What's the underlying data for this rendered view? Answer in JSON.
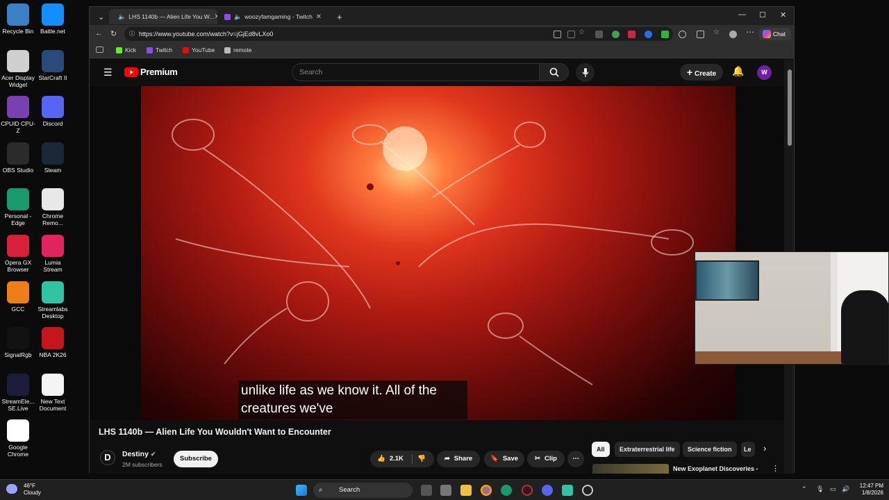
{
  "desktop": {
    "icons": [
      {
        "label": "Recycle Bin",
        "icon": "recycle-bin-icon",
        "color": "#3b7fc4"
      },
      {
        "label": "Battle.net",
        "icon": "battlenet-icon",
        "color": "#148eff"
      },
      {
        "label": "Acer Display Widget",
        "icon": "acer-display-icon",
        "color": "#cfcfcf"
      },
      {
        "label": "StarCraft II",
        "icon": "starcraft-icon",
        "color": "#2a4a7a"
      },
      {
        "label": "CPUID CPU-Z",
        "icon": "cpuz-icon",
        "color": "#7a3fb0"
      },
      {
        "label": "Discord",
        "icon": "discord-icon",
        "color": "#5865f2"
      },
      {
        "label": "OBS Studio",
        "icon": "obs-icon",
        "color": "#2b2b2b"
      },
      {
        "label": "Steam",
        "icon": "steam-icon",
        "color": "#1b2838"
      },
      {
        "label": "Personal - Edge",
        "icon": "edge-icon",
        "color": "#1a9a6c"
      },
      {
        "label": "Chrome Remo...",
        "icon": "chrome-remote-icon",
        "color": "#e8e8e8"
      },
      {
        "label": "Opera GX Browser",
        "icon": "opera-gx-icon",
        "color": "#d8203a"
      },
      {
        "label": "Lumia Stream",
        "icon": "lumia-icon",
        "color": "#e0245e"
      },
      {
        "label": "GCC",
        "icon": "gcc-icon",
        "color": "#ef7d1a"
      },
      {
        "label": "Streamlabs Desktop",
        "icon": "streamlabs-icon",
        "color": "#31c3a2"
      },
      {
        "label": "SignalRgb",
        "icon": "signalrgb-icon",
        "color": "#121212"
      },
      {
        "label": "NBA 2K26",
        "icon": "nba2k-icon",
        "color": "#c4161c"
      },
      {
        "label": "StreamEle... SE.Live",
        "icon": "streamelements-icon",
        "color": "#1d1d3a"
      },
      {
        "label": "New Text Document",
        "icon": "text-document-icon",
        "color": "#f4f4f4"
      },
      {
        "label": "Google Chrome",
        "icon": "chrome-icon",
        "color": "#ffffff"
      }
    ]
  },
  "browser": {
    "tabs": [
      {
        "label": "LHS 1140b — Alien Life You W...",
        "active": true
      },
      {
        "label": "woozyfamgaming - Twitch",
        "active": false
      }
    ],
    "url": "https://www.youtube.com/watch?v=jGjEd8vLXo0",
    "chat_label": "Chat",
    "bookmarks": [
      {
        "label": "Kick",
        "color": "#53fc18"
      },
      {
        "label": "Twitch",
        "color": "#9146ff"
      },
      {
        "label": "YouTube",
        "color": "#ff0000"
      },
      {
        "label": "remote",
        "color": "#bbbbbb"
      }
    ]
  },
  "youtube": {
    "logo_text": "Premium",
    "search_placeholder": "Search",
    "create_label": "Create",
    "avatar_letter": "W",
    "caption_text": "unlike life as we know it. All of the creatures we've",
    "video_title": "LHS 1140b — Alien Life You Wouldn't Want to Encounter",
    "channel": {
      "name": "Destiny",
      "subscribers": "2M subscribers",
      "logo": "D"
    },
    "subscribe_label": "Subscribe",
    "likes": "2.1K",
    "share_label": "Share",
    "save_label": "Save",
    "clip_label": "Clip",
    "chips": [
      "All",
      "Extraterrestrial life",
      "Science fiction",
      "Le"
    ],
    "recommendation": {
      "title": "New Exoplanet Discoveries - Could They Be Better than"
    }
  },
  "taskbar": {
    "search_label": "Search",
    "weather_temp": "46°F",
    "weather_desc": "Cloudy",
    "time": "12:47 PM",
    "date": "1/8/2026"
  }
}
